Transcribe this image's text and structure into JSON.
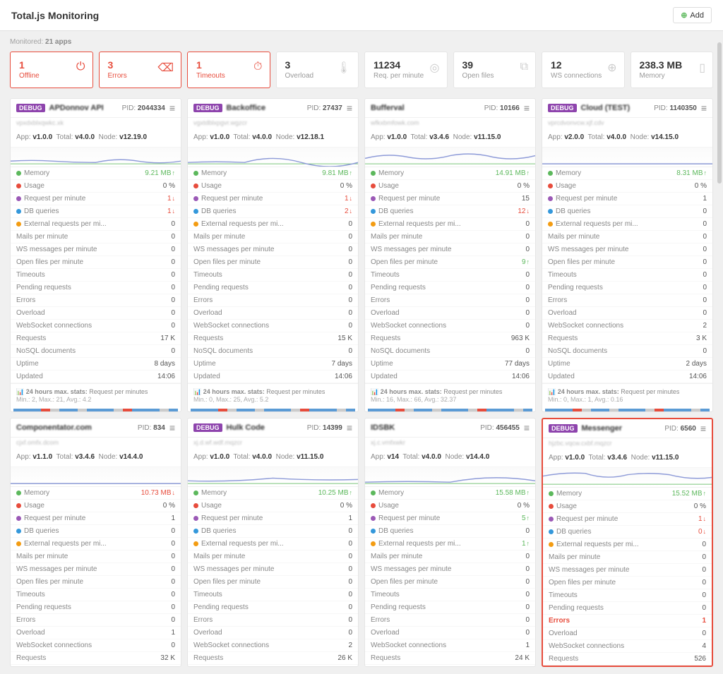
{
  "header": {
    "title": "Total.js Monitoring",
    "add_label": "Add"
  },
  "monitored": {
    "label": "Monitored:",
    "count": "21 apps"
  },
  "summary": [
    {
      "value": "1",
      "label": "Offline",
      "red": true,
      "icon": "⏻"
    },
    {
      "value": "3",
      "label": "Errors",
      "red": true,
      "icon": "⌫"
    },
    {
      "value": "1",
      "label": "Timeouts",
      "red": true,
      "icon": "⏱"
    },
    {
      "value": "3",
      "label": "Overload",
      "icon": "🌡"
    },
    {
      "value": "11234",
      "label": "Req. per minute",
      "icon": "◎"
    },
    {
      "value": "39",
      "label": "Open files",
      "icon": "⧉"
    },
    {
      "value": "12",
      "label": "WS connections",
      "icon": "⊕"
    },
    {
      "value": "238.3 MB",
      "label": "Memory",
      "icon": "▯"
    }
  ],
  "metric_defs": [
    {
      "key": "memory",
      "label": "Memory",
      "color": "#5cb85c"
    },
    {
      "key": "usage",
      "label": "Usage",
      "color": "#e74c3c"
    },
    {
      "key": "rpm",
      "label": "Request per minute",
      "color": "#9b59b6"
    },
    {
      "key": "db",
      "label": "DB queries",
      "color": "#3498db"
    },
    {
      "key": "ext",
      "label": "External requests per mi...",
      "color": "#f39c12"
    },
    {
      "key": "mails",
      "label": "Mails per minute"
    },
    {
      "key": "ws",
      "label": "WS messages per minute"
    },
    {
      "key": "open",
      "label": "Open files per minute"
    },
    {
      "key": "timeouts",
      "label": "Timeouts"
    },
    {
      "key": "pending",
      "label": "Pending requests"
    },
    {
      "key": "errors",
      "label": "Errors"
    },
    {
      "key": "overload",
      "label": "Overload"
    },
    {
      "key": "wsc",
      "label": "WebSocket connections"
    },
    {
      "key": "req",
      "label": "Requests"
    },
    {
      "key": "nosql",
      "label": "NoSQL documents"
    },
    {
      "key": "uptime",
      "label": "Uptime"
    },
    {
      "key": "updated",
      "label": "Updated"
    }
  ],
  "foot": {
    "prefix": "24 hours max. stats:",
    "metric": "Request per minutes"
  },
  "cards": [
    {
      "debug": true,
      "name": "APDonnov API",
      "sub": "vpxdxblxqwkc.xk",
      "pid": "2044334",
      "app": "v1.0.0",
      "total": "v4.0.0",
      "node": "v12.19.0",
      "metrics": {
        "memory": {
          "v": "9.21 MB",
          "d": "up"
        },
        "usage": {
          "v": "0 %"
        },
        "rpm": {
          "v": "1",
          "d": "down"
        },
        "db": {
          "v": "1",
          "d": "down"
        },
        "ext": {
          "v": "0"
        },
        "mails": {
          "v": "0"
        },
        "ws": {
          "v": "0"
        },
        "open": {
          "v": "0"
        },
        "timeouts": {
          "v": "0"
        },
        "pending": {
          "v": "0"
        },
        "errors": {
          "v": "0"
        },
        "overload": {
          "v": "0"
        },
        "wsc": {
          "v": "0"
        },
        "req": {
          "v": "17 K"
        },
        "nosql": {
          "v": "0"
        },
        "uptime": {
          "v": "8 days"
        },
        "updated": {
          "v": "14:06"
        }
      },
      "stats": "Min.: 2, Max.: 21, Avg.: 4.2"
    },
    {
      "debug": true,
      "name": "Backoffice",
      "sub": "vgxtdblxpgvr.wgzcr",
      "pid": "27437",
      "app": "v1.0.0",
      "total": "v4.0.0",
      "node": "v12.18.1",
      "metrics": {
        "memory": {
          "v": "9.81 MB",
          "d": "up"
        },
        "usage": {
          "v": "0 %"
        },
        "rpm": {
          "v": "1",
          "d": "down"
        },
        "db": {
          "v": "2",
          "d": "down"
        },
        "ext": {
          "v": "0"
        },
        "mails": {
          "v": "0"
        },
        "ws": {
          "v": "0"
        },
        "open": {
          "v": "0"
        },
        "timeouts": {
          "v": "0"
        },
        "pending": {
          "v": "0"
        },
        "errors": {
          "v": "0"
        },
        "overload": {
          "v": "0"
        },
        "wsc": {
          "v": "0"
        },
        "req": {
          "v": "15 K"
        },
        "nosql": {
          "v": "0"
        },
        "uptime": {
          "v": "7 days"
        },
        "updated": {
          "v": "14:06"
        }
      },
      "stats": "Min.: 0, Max.: 25, Avg.: 5.2"
    },
    {
      "debug": false,
      "name": "Bufferval",
      "sub": "wfkxbmfowk.com",
      "pid": "10166",
      "app": "v1.0.0",
      "total": "v3.4.6",
      "node": "v11.15.0",
      "metrics": {
        "memory": {
          "v": "14.91 MB",
          "d": "up"
        },
        "usage": {
          "v": "0 %"
        },
        "rpm": {
          "v": "15"
        },
        "db": {
          "v": "12",
          "d": "down"
        },
        "ext": {
          "v": "0"
        },
        "mails": {
          "v": "0"
        },
        "ws": {
          "v": "0"
        },
        "open": {
          "v": "9",
          "d": "up"
        },
        "timeouts": {
          "v": "0"
        },
        "pending": {
          "v": "0"
        },
        "errors": {
          "v": "0"
        },
        "overload": {
          "v": "0"
        },
        "wsc": {
          "v": "0"
        },
        "req": {
          "v": "963 K"
        },
        "nosql": {
          "v": "0"
        },
        "uptime": {
          "v": "77 days"
        },
        "updated": {
          "v": "14:06"
        }
      },
      "stats": "Min.: 16, Max.: 66, Avg.: 32.37"
    },
    {
      "debug": true,
      "name": "Cloud (TEST)",
      "sub": "vprcdvonvcw.xjf.cdv",
      "pid": "1140350",
      "app": "v2.0.0",
      "total": "v4.0.0",
      "node": "v14.15.0",
      "metrics": {
        "memory": {
          "v": "8.31 MB",
          "d": "up"
        },
        "usage": {
          "v": "0 %"
        },
        "rpm": {
          "v": "1"
        },
        "db": {
          "v": "0"
        },
        "ext": {
          "v": "0"
        },
        "mails": {
          "v": "0"
        },
        "ws": {
          "v": "0"
        },
        "open": {
          "v": "0"
        },
        "timeouts": {
          "v": "0"
        },
        "pending": {
          "v": "0"
        },
        "errors": {
          "v": "0"
        },
        "overload": {
          "v": "0"
        },
        "wsc": {
          "v": "2"
        },
        "req": {
          "v": "3 K"
        },
        "nosql": {
          "v": "0"
        },
        "uptime": {
          "v": "2 days"
        },
        "updated": {
          "v": "14:06"
        }
      },
      "stats": "Min.: 0, Max.: 1, Avg.: 0.16"
    },
    {
      "debug": false,
      "name": "Componentator.com",
      "sub": "cjxf.omfx.dcom",
      "pid": "834",
      "app": "v1.1.0",
      "total": "v3.4.6",
      "node": "v14.4.0",
      "metrics": {
        "memory": {
          "v": "10.73 MB",
          "d": "down"
        },
        "usage": {
          "v": "0 %"
        },
        "rpm": {
          "v": "1"
        },
        "db": {
          "v": "0"
        },
        "ext": {
          "v": "0"
        },
        "mails": {
          "v": "0"
        },
        "ws": {
          "v": "0"
        },
        "open": {
          "v": "0"
        },
        "timeouts": {
          "v": "0"
        },
        "pending": {
          "v": "0"
        },
        "errors": {
          "v": "0"
        },
        "overload": {
          "v": "1"
        },
        "wsc": {
          "v": "0"
        },
        "req": {
          "v": "32 K"
        }
      },
      "stats": ""
    },
    {
      "debug": true,
      "name": "Hulk Code",
      "sub": "xj.d.wf.wdf.mqzcr",
      "pid": "14399",
      "app": "v1.0.0",
      "total": "v4.0.0",
      "node": "v11.15.0",
      "metrics": {
        "memory": {
          "v": "10.25 MB",
          "d": "up"
        },
        "usage": {
          "v": "0 %"
        },
        "rpm": {
          "v": "1"
        },
        "db": {
          "v": "0"
        },
        "ext": {
          "v": "0"
        },
        "mails": {
          "v": "0"
        },
        "ws": {
          "v": "0"
        },
        "open": {
          "v": "0"
        },
        "timeouts": {
          "v": "0"
        },
        "pending": {
          "v": "0"
        },
        "errors": {
          "v": "0"
        },
        "overload": {
          "v": "0"
        },
        "wsc": {
          "v": "2"
        },
        "req": {
          "v": "26 K"
        }
      },
      "stats": ""
    },
    {
      "debug": false,
      "name": "IDSBK",
      "sub": "xj.c.vmfxwkr",
      "pid": "456455",
      "app": "v14",
      "total": "v4.0.0",
      "node": "v14.4.0",
      "metrics": {
        "memory": {
          "v": "15.58 MB",
          "d": "up"
        },
        "usage": {
          "v": "0 %"
        },
        "rpm": {
          "v": "5",
          "d": "up"
        },
        "db": {
          "v": "0"
        },
        "ext": {
          "v": "1",
          "d": "up"
        },
        "mails": {
          "v": "0"
        },
        "ws": {
          "v": "0"
        },
        "open": {
          "v": "0"
        },
        "timeouts": {
          "v": "0"
        },
        "pending": {
          "v": "0"
        },
        "errors": {
          "v": "0"
        },
        "overload": {
          "v": "0"
        },
        "wsc": {
          "v": "1"
        },
        "req": {
          "v": "24 K"
        }
      },
      "stats": ""
    },
    {
      "debug": true,
      "alert": true,
      "name": "Messenger",
      "sub": "hjzbc.vqcw.cxbf.mqzcr",
      "pid": "6560",
      "app": "v1.0.0",
      "total": "v3.4.6",
      "node": "v11.15.0",
      "metrics": {
        "memory": {
          "v": "15.52 MB",
          "d": "up"
        },
        "usage": {
          "v": "0 %"
        },
        "rpm": {
          "v": "1",
          "d": "down"
        },
        "db": {
          "v": "0",
          "d": "down"
        },
        "ext": {
          "v": "0"
        },
        "mails": {
          "v": "0"
        },
        "ws": {
          "v": "0"
        },
        "open": {
          "v": "0"
        },
        "timeouts": {
          "v": "0"
        },
        "pending": {
          "v": "0"
        },
        "errors": {
          "v": "1",
          "err": true
        },
        "overload": {
          "v": "0"
        },
        "wsc": {
          "v": "4"
        },
        "req": {
          "v": "526"
        }
      },
      "stats": ""
    }
  ]
}
